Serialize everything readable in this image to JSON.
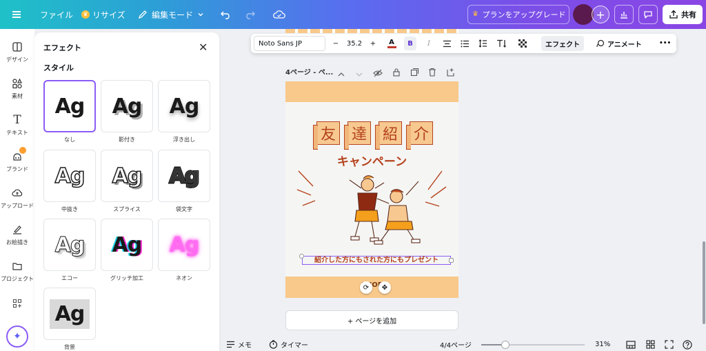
{
  "topbar": {
    "file_label": "ファイル",
    "resize_label": "リサイズ",
    "edit_mode_label": "編集モード",
    "upgrade_label": "プランをアップグレード",
    "share_label": "共有"
  },
  "rail": {
    "items": [
      {
        "label": "デザイン",
        "icon": "design-icon"
      },
      {
        "label": "素材",
        "icon": "elements-icon"
      },
      {
        "label": "テキスト",
        "icon": "text-icon"
      },
      {
        "label": "ブランド",
        "icon": "brand-icon"
      },
      {
        "label": "アップロード",
        "icon": "upload-icon"
      },
      {
        "label": "お絵描き",
        "icon": "draw-icon"
      },
      {
        "label": "プロジェクト",
        "icon": "folder-icon"
      }
    ]
  },
  "panel": {
    "title": "エフェクト",
    "section": "スタイル",
    "sample_text": "Ag",
    "styles": [
      {
        "label": "なし"
      },
      {
        "label": "影付き"
      },
      {
        "label": "浮き出し"
      },
      {
        "label": "中抜き"
      },
      {
        "label": "スプライス"
      },
      {
        "label": "袋文字"
      },
      {
        "label": "エコー"
      },
      {
        "label": "グリッチ加工"
      },
      {
        "label": "ネオン"
      },
      {
        "label": "背景"
      }
    ]
  },
  "toolbar": {
    "font": "Noto Sans JP",
    "size": "35.2",
    "minus": "−",
    "plus": "+",
    "effects_label": "エフェクト",
    "animate_label": "アニメート",
    "more": "•••",
    "bold": "B",
    "italic": "I",
    "text_color_letter": "A",
    "text_color": "#c0392b"
  },
  "page_header": {
    "label": "4ページ - ペ..."
  },
  "canvas": {
    "kanji": [
      "友",
      "達",
      "紹",
      "介"
    ],
    "campaign": "キャンペーン",
    "selected_text": "紹介した方にもされた方にもプレゼント",
    "footer_text": "SHOP"
  },
  "add_page_label": "+ ページを追加",
  "bottombar": {
    "memo_label": "メモ",
    "timer_label": "タイマー",
    "page_count": "4/4ページ",
    "zoom": "31%",
    "zoom_level": 0.31
  },
  "colors": {
    "accent": "#8b5cf6",
    "page_band": "#f8c98a",
    "design_red": "#b5421c"
  }
}
